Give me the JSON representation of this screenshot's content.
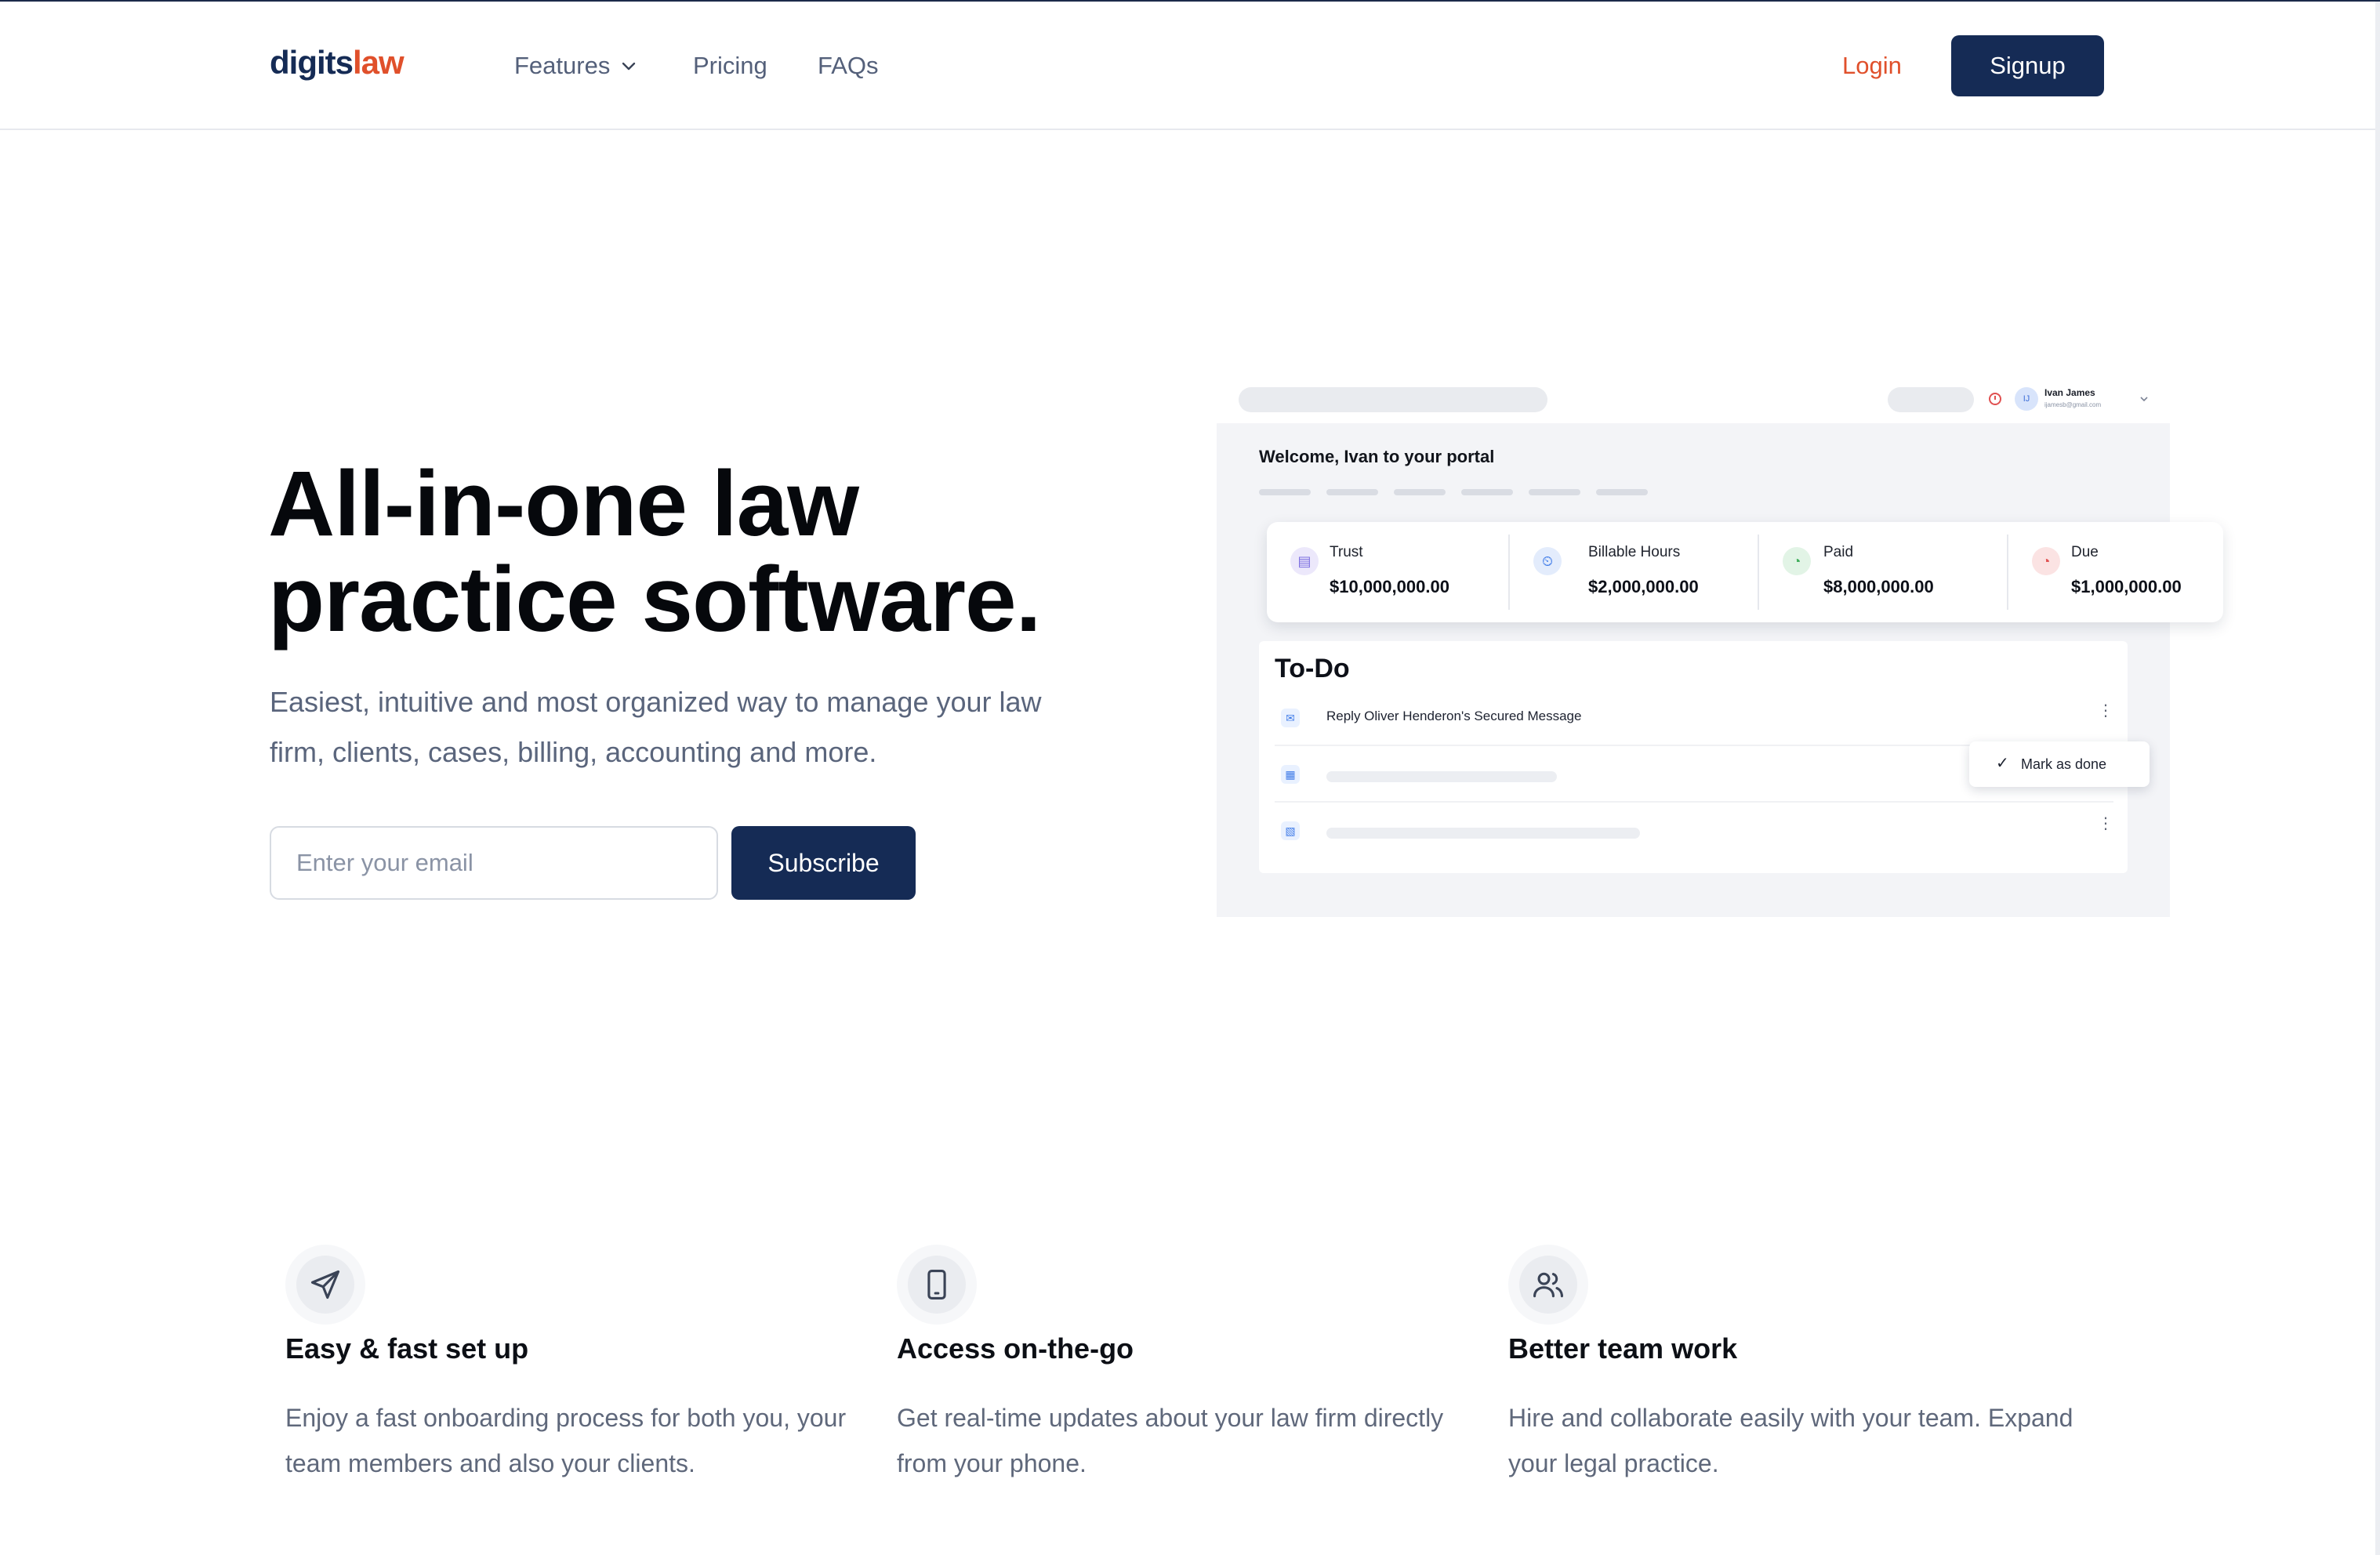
{
  "header": {
    "logo_part1": "digits",
    "logo_part2": "law",
    "nav": {
      "features": "Features",
      "pricing": "Pricing",
      "faqs": "FAQs"
    },
    "login": "Login",
    "signup": "Signup"
  },
  "hero": {
    "title_line1": "All-in-one law",
    "title_line2": "practice software.",
    "subtitle": "Easiest, intuitive and most organized way to manage your law firm, clients, cases, billing, accounting and more.",
    "email_placeholder": "Enter your email",
    "subscribe": "Subscribe"
  },
  "portal": {
    "user_name": "Ivan James",
    "user_initial": "IJ",
    "user_email": "ijamesb@gmail.com",
    "welcome": "Welcome, Ivan to your portal",
    "stats": [
      {
        "label": "Trust",
        "value": "$10,000,000.00",
        "icon": "trust-icon",
        "color": "#7b6ee0"
      },
      {
        "label": "Billable Hours",
        "value": "$2,000,000.00",
        "icon": "billable-hours-icon",
        "color": "#3f7be8"
      },
      {
        "label": "Paid",
        "value": "$8,000,000.00",
        "icon": "paid-icon",
        "color": "#3fae5a"
      },
      {
        "label": "Due",
        "value": "$1,000,000.00",
        "icon": "due-icon",
        "color": "#e05050"
      }
    ],
    "todo_title": "To-Do",
    "todo_item1": "Reply Oliver Henderon's Secured Message",
    "mark_done": "Mark as done"
  },
  "features": [
    {
      "title": "Easy & fast set up",
      "desc": "Enjoy a fast onboarding process for both you, your team members and also your clients.",
      "icon": "paper-plane-icon"
    },
    {
      "title": "Access on-the-go",
      "desc": "Get real-time updates about your law firm directly from your phone.",
      "icon": "mobile-phone-icon"
    },
    {
      "title": "Better team work",
      "desc": "Hire and collaborate easily with your team. Expand your legal practice.",
      "icon": "team-users-icon"
    }
  ]
}
